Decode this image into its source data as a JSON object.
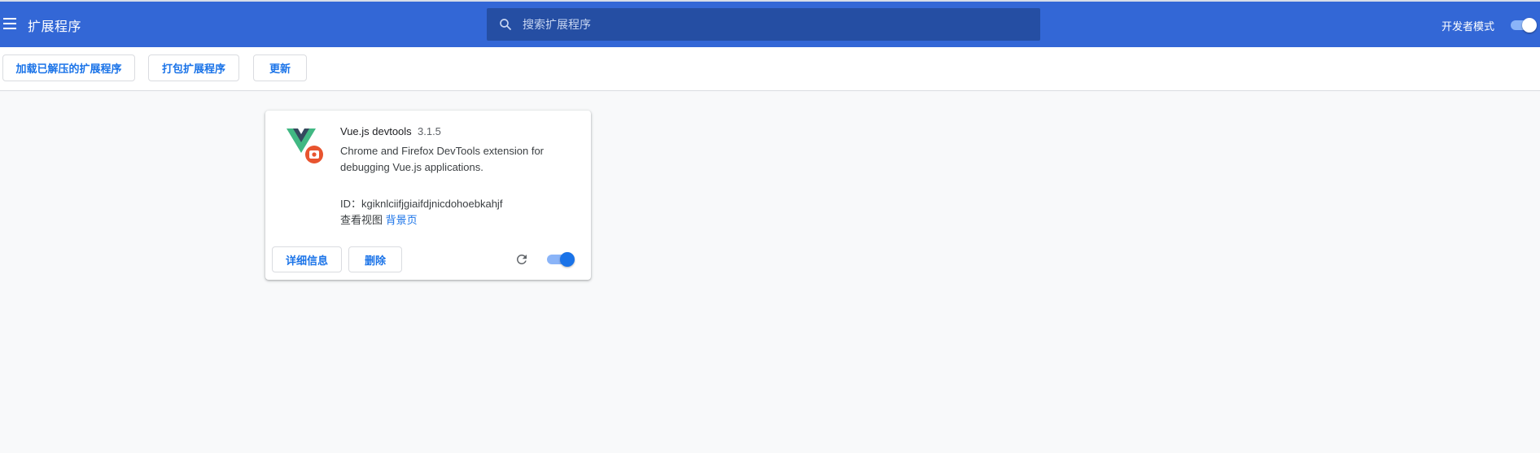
{
  "header": {
    "title": "扩展程序",
    "search_placeholder": "搜索扩展程序",
    "dev_mode_label": "开发者模式",
    "dev_mode_on": true
  },
  "toolbar": {
    "load_unpacked": "加载已解压的扩展程序",
    "pack": "打包扩展程序",
    "update": "更新"
  },
  "extension": {
    "name": "Vue.js devtools",
    "version": "3.1.5",
    "description": "Chrome and Firefox DevTools extension for debugging Vue.js applications.",
    "id_text": "ID：kgiknlciifjgiaifdjnicdohoebkahjf",
    "inspect_views_label": "查看视图",
    "inspect_link": "背景页",
    "details_button": "详细信息",
    "remove_button": "删除",
    "enabled": true,
    "icon": "vue-logo-icon"
  },
  "colors": {
    "header_bg": "#3367d6",
    "search_bg": "#254ea3",
    "accent": "#1a73e8",
    "page_bg": "#f8f9fa"
  }
}
